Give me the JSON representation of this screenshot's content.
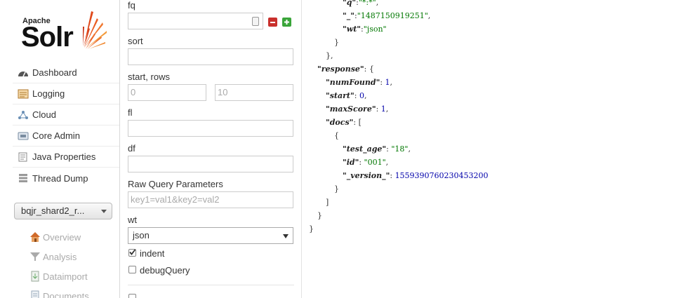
{
  "logo": {
    "line1": "Apache",
    "line2": "Solr"
  },
  "nav": [
    {
      "label": "Dashboard",
      "icon": "dashboard-icon"
    },
    {
      "label": "Logging",
      "icon": "logging-icon"
    },
    {
      "label": "Cloud",
      "icon": "cloud-icon"
    },
    {
      "label": "Core Admin",
      "icon": "core-admin-icon"
    },
    {
      "label": "Java Properties",
      "icon": "java-properties-icon"
    },
    {
      "label": "Thread Dump",
      "icon": "thread-dump-icon"
    }
  ],
  "core_selector": {
    "value": "bqjr_shard2_r..."
  },
  "core_menu": [
    {
      "label": "Overview",
      "icon": "home-icon"
    },
    {
      "label": "Analysis",
      "icon": "funnel-icon"
    },
    {
      "label": "Dataimport",
      "icon": "dataimport-icon"
    },
    {
      "label": "Documents",
      "icon": "documents-icon"
    }
  ],
  "form": {
    "fq_label": "fq",
    "fq_value": "",
    "sort_label": "sort",
    "sort_value": "",
    "start_rows_label": "start, rows",
    "start_placeholder": "0",
    "rows_placeholder": "10",
    "fl_label": "fl",
    "df_label": "df",
    "raw_label": "Raw Query Parameters",
    "raw_placeholder": "key1=val1&key2=val2",
    "wt_label": "wt",
    "wt_value": "json",
    "indent_label": "indent",
    "indent_checked": true,
    "debug_label": "debugQuery",
    "debug_checked": false
  },
  "response_lines": [
    {
      "indent": 4,
      "parts": [
        {
          "t": "k",
          "v": "\"q\""
        },
        {
          "t": "p",
          "v": ":"
        },
        {
          "t": "s",
          "v": "\"*:*\""
        },
        {
          "t": "p",
          "v": ","
        }
      ]
    },
    {
      "indent": 4,
      "parts": [
        {
          "t": "k",
          "v": "\"_\""
        },
        {
          "t": "p",
          "v": ":"
        },
        {
          "t": "s",
          "v": "\"1487150919251\""
        },
        {
          "t": "p",
          "v": ","
        }
      ]
    },
    {
      "indent": 4,
      "parts": [
        {
          "t": "k",
          "v": "\"wt\""
        },
        {
          "t": "p",
          "v": ":"
        },
        {
          "t": "s",
          "v": "\"json\""
        }
      ]
    },
    {
      "indent": 3,
      "parts": [
        {
          "t": "p",
          "v": "}"
        }
      ]
    },
    {
      "indent": 2,
      "parts": [
        {
          "t": "p",
          "v": "},"
        }
      ]
    },
    {
      "indent": 1,
      "parts": [
        {
          "t": "k",
          "v": "\"response\""
        },
        {
          "t": "p",
          "v": ": {"
        }
      ]
    },
    {
      "indent": 2,
      "parts": [
        {
          "t": "k",
          "v": "\"numFound\""
        },
        {
          "t": "p",
          "v": ": "
        },
        {
          "t": "n",
          "v": "1"
        },
        {
          "t": "p",
          "v": ","
        }
      ]
    },
    {
      "indent": 2,
      "parts": [
        {
          "t": "k",
          "v": "\"start\""
        },
        {
          "t": "p",
          "v": ": "
        },
        {
          "t": "n",
          "v": "0"
        },
        {
          "t": "p",
          "v": ","
        }
      ]
    },
    {
      "indent": 2,
      "parts": [
        {
          "t": "k",
          "v": "\"maxScore\""
        },
        {
          "t": "p",
          "v": ": "
        },
        {
          "t": "n",
          "v": "1"
        },
        {
          "t": "p",
          "v": ","
        }
      ]
    },
    {
      "indent": 2,
      "parts": [
        {
          "t": "k",
          "v": "\"docs\""
        },
        {
          "t": "p",
          "v": ": ["
        }
      ]
    },
    {
      "indent": 3,
      "parts": [
        {
          "t": "p",
          "v": "{"
        }
      ]
    },
    {
      "indent": 4,
      "parts": [
        {
          "t": "k",
          "v": "\"test_age\""
        },
        {
          "t": "p",
          "v": ": "
        },
        {
          "t": "s",
          "v": "\"18\""
        },
        {
          "t": "p",
          "v": ","
        }
      ]
    },
    {
      "indent": 4,
      "parts": [
        {
          "t": "k",
          "v": "\"id\""
        },
        {
          "t": "p",
          "v": ": "
        },
        {
          "t": "s",
          "v": "\"001\""
        },
        {
          "t": "p",
          "v": ","
        }
      ]
    },
    {
      "indent": 4,
      "parts": [
        {
          "t": "k",
          "v": "\"_version_\""
        },
        {
          "t": "p",
          "v": ": "
        },
        {
          "t": "n",
          "v": "1559390760230453200"
        }
      ]
    },
    {
      "indent": 3,
      "parts": [
        {
          "t": "p",
          "v": "}"
        }
      ]
    },
    {
      "indent": 2,
      "parts": [
        {
          "t": "p",
          "v": "]"
        }
      ]
    },
    {
      "indent": 1,
      "parts": [
        {
          "t": "p",
          "v": "}"
        }
      ]
    },
    {
      "indent": 0,
      "parts": [
        {
          "t": "p",
          "v": "}"
        }
      ]
    }
  ]
}
